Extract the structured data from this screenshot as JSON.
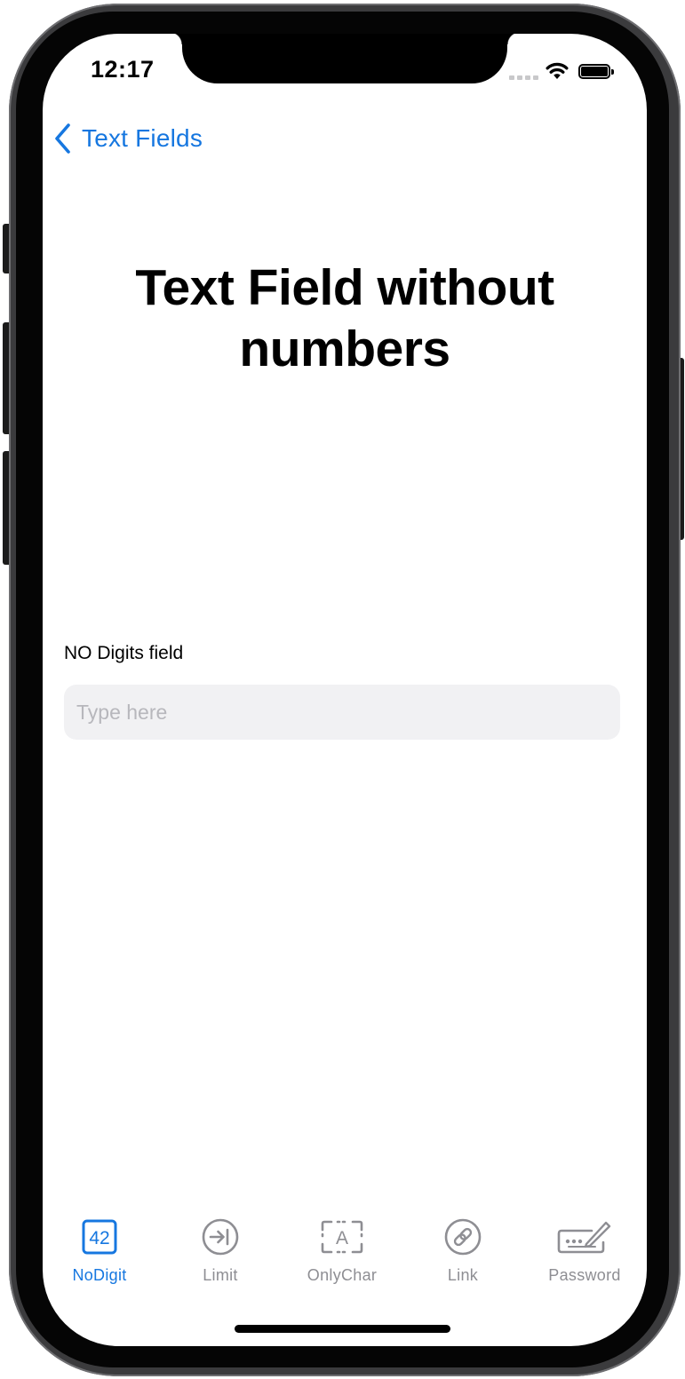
{
  "status_bar": {
    "time": "12:17"
  },
  "nav": {
    "back_label": "Text Fields"
  },
  "page": {
    "title_line1": "Text Field without",
    "title_line2": "numbers"
  },
  "field": {
    "label": "NO Digits field",
    "placeholder": "Type here",
    "value": ""
  },
  "tabs": [
    {
      "label": "NoDigit",
      "icon": "number-42-square-icon",
      "selected": true
    },
    {
      "label": "Limit",
      "icon": "arrow-right-to-line-circle-icon",
      "selected": false
    },
    {
      "label": "OnlyChar",
      "icon": "character-a-viewfinder-icon",
      "selected": false
    },
    {
      "label": "Link",
      "icon": "link-circle-icon",
      "selected": false
    },
    {
      "label": "Password",
      "icon": "password-signature-icon",
      "selected": false
    }
  ],
  "tab_icon_text": {
    "nodigit": "42",
    "onlychar": "A"
  },
  "colors": {
    "accent": "#1677e0",
    "inactive": "#8e8e93",
    "field_bg": "#f1f1f3",
    "placeholder": "#b7b7bc"
  }
}
